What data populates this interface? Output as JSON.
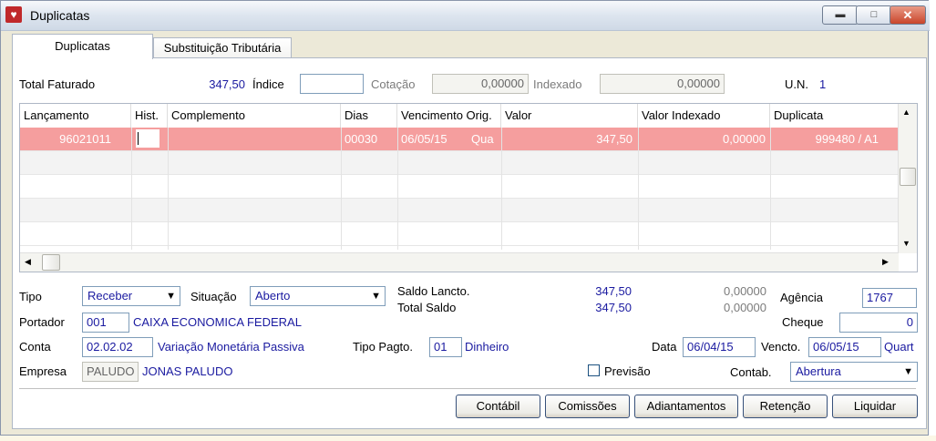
{
  "window": {
    "title": "Duplicatas"
  },
  "tabs": [
    {
      "label": "Duplicatas"
    },
    {
      "label": "Substituição Tributária"
    }
  ],
  "header": {
    "total_faturado_label": "Total Faturado",
    "total_faturado_value": "347,50",
    "indice_label": "Índice",
    "indice_value": "",
    "cotacao_label": "Cotação",
    "cotacao_value": "0,00000",
    "indexado_label": "Indexado",
    "indexado_value": "0,00000",
    "un_label": "U.N.",
    "un_value": "1"
  },
  "grid": {
    "columns": [
      "Lançamento",
      "Hist.",
      "Complemento",
      "Dias",
      "Vencimento Orig.",
      "Valor",
      "Valor Indexado",
      "Duplicata"
    ],
    "rows": [
      {
        "lancamento": "96021011",
        "hist": "",
        "complemento": "",
        "dias": "00030",
        "vencimento": "06/05/15",
        "dia_semana": "Qua",
        "valor": "347,50",
        "valor_indexado": "0,00000",
        "duplicata": "999480 / A1"
      }
    ]
  },
  "form": {
    "tipo_label": "Tipo",
    "tipo_value": "Receber",
    "situacao_label": "Situação",
    "situacao_value": "Aberto",
    "saldo_lancto_label": "Saldo Lancto.",
    "saldo_lancto_value": "347,50",
    "saldo_lancto_indexado": "0,00000",
    "total_saldo_label": "Total Saldo",
    "total_saldo_value": "347,50",
    "total_saldo_indexado": "0,00000",
    "agencia_label": "Agência",
    "agencia_value": "1767",
    "portador_label": "Portador",
    "portador_code": "001",
    "portador_name": "CAIXA ECONOMICA FEDERAL",
    "cheque_label": "Cheque",
    "cheque_value": "0",
    "conta_label": "Conta",
    "conta_code": "02.02.02",
    "conta_name": "Variação Monetária Passiva",
    "tipo_pagto_label": "Tipo Pagto.",
    "tipo_pagto_code": "01",
    "tipo_pagto_name": "Dinheiro",
    "data_label": "Data",
    "data_value": "06/04/15",
    "vencto_label": "Vencto.",
    "vencto_value": "06/05/15",
    "vencto_day": "Quart",
    "empresa_label": "Empresa",
    "empresa_code": "PALUDO",
    "empresa_name": "JONAS PALUDO",
    "previsao_label": "Previsão",
    "contab_label": "Contab.",
    "contab_value": "Abertura"
  },
  "buttons": {
    "contabil": "Contábil",
    "comissoes": "Comissões",
    "adiantamentos": "Adiantamentos",
    "retencao": "Retenção",
    "liquidar": "Liquidar"
  },
  "colors": {
    "selected_row": "#f59e9e",
    "value_blue": "#1a1aa0",
    "titlebar": "#dde5ef"
  }
}
